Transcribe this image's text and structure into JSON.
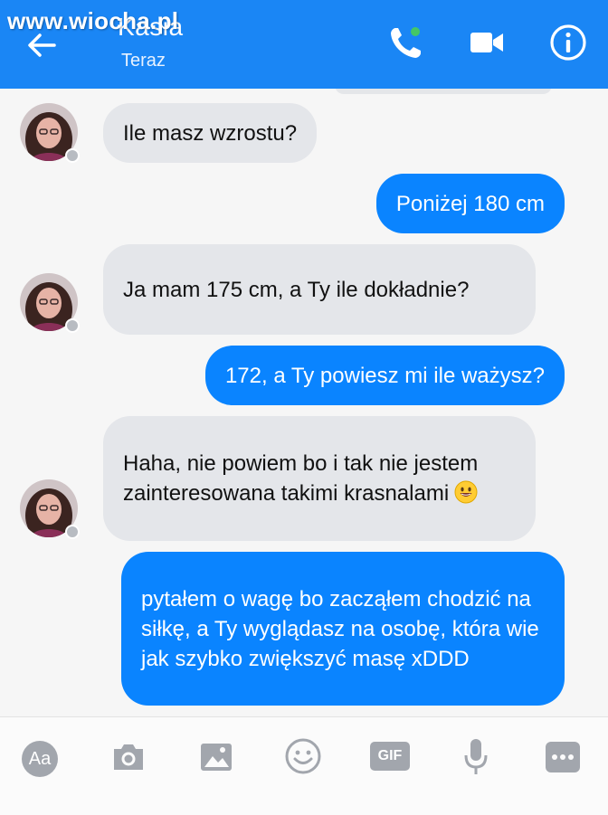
{
  "watermark": "www.wiocha.pl",
  "header": {
    "contact_name": "Kasia",
    "presence": "Teraz",
    "accent": "#1a86f5",
    "icons": [
      "back-arrow-icon",
      "phone-call-icon",
      "video-camera-icon",
      "info-icon"
    ]
  },
  "messages": [
    {
      "from": "them",
      "text": "Ile masz wzrostu?"
    },
    {
      "from": "me",
      "text": "Poniżej 180 cm"
    },
    {
      "from": "them",
      "text": "Ja mam 175 cm, a Ty ile dokładnie?"
    },
    {
      "from": "me",
      "text": "172, a Ty powiesz mi ile ważysz?"
    },
    {
      "from": "them",
      "text": "Haha, nie powiem bo i tak nie jestem zainteresowana takimi krasnalami",
      "emoji": "grinning-face-icon"
    },
    {
      "from": "me",
      "text": "pytałem o wagę bo zacząłem chodzić na siłkę, a Ty wyglądasz na osobę, która wie jak szybko zwiększyć masę xDDD"
    }
  ],
  "composer": {
    "font_button": "Aa",
    "gif_button": "GIF",
    "icons": [
      "text-format-icon",
      "camera-icon",
      "image-icon",
      "emoji-icon",
      "gif-icon",
      "microphone-icon",
      "more-icon"
    ]
  }
}
